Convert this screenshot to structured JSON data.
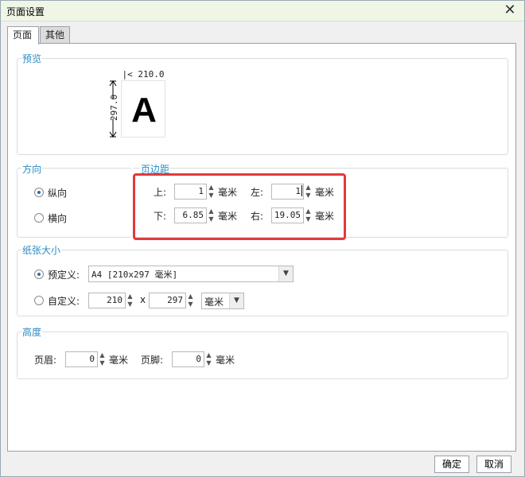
{
  "window": {
    "title": "页面设置"
  },
  "tabs": [
    {
      "label": "页面"
    },
    {
      "label": "其他"
    }
  ],
  "preview": {
    "label": "预览",
    "width_text": "|< 210.0 >|",
    "height_text": "297.0",
    "letter": "A"
  },
  "orientation": {
    "label": "方向",
    "options": [
      {
        "label": "纵向",
        "checked": true
      },
      {
        "label": "横向",
        "checked": false
      }
    ]
  },
  "margins": {
    "label": "页边距",
    "top": {
      "label": "上:",
      "value": "1",
      "unit": "毫米"
    },
    "left": {
      "label": "左:",
      "value": "1",
      "unit": "毫米"
    },
    "bottom": {
      "label": "下:",
      "value": "6.85",
      "unit": "毫米"
    },
    "right": {
      "label": "右:",
      "value": "19.05",
      "unit": "毫米"
    }
  },
  "paper": {
    "label": "纸张大小",
    "predefined": {
      "label": "预定义:",
      "value": "A4 [210x297 毫米]",
      "checked": true
    },
    "custom": {
      "label": "自定义:",
      "width": "210",
      "times": "x",
      "height": "297",
      "unit": "毫米",
      "checked": false
    }
  },
  "height": {
    "label": "高度",
    "header": {
      "label": "页眉:",
      "value": "0",
      "unit": "毫米"
    },
    "footer": {
      "label": "页脚:",
      "value": "0",
      "unit": "毫米"
    }
  },
  "buttons": {
    "ok": "确定",
    "cancel": "取消"
  }
}
